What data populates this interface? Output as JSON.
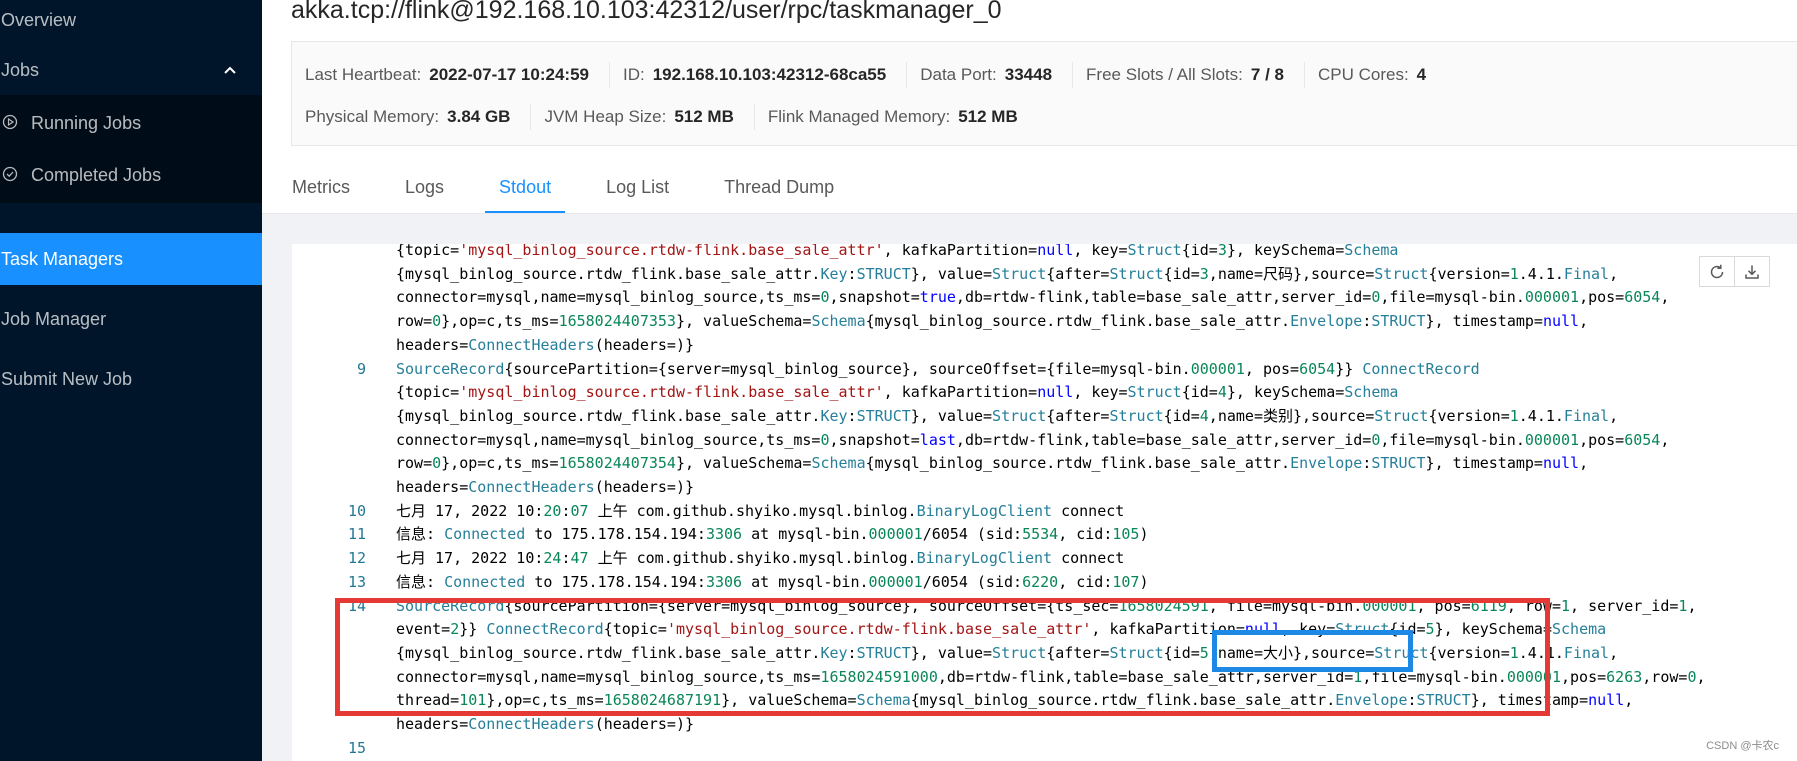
{
  "sidebar": {
    "items": [
      {
        "label": "Overview"
      },
      {
        "label": "Jobs"
      },
      {
        "label": "Running Jobs"
      },
      {
        "label": "Completed Jobs"
      },
      {
        "label": "Task Managers"
      },
      {
        "label": "Job Manager"
      },
      {
        "label": "Submit New Job"
      }
    ]
  },
  "header": {
    "title": "akka.tcp://flink@192.168.10.103:42312/user/rpc/taskmanager_0"
  },
  "descriptions": {
    "last_heartbeat_label": "Last Heartbeat:",
    "last_heartbeat": "2022-07-17 10:24:59",
    "id_label": "ID:",
    "id": "192.168.10.103:42312-68ca55",
    "data_port_label": "Data Port:",
    "data_port": "33448",
    "slots_label": "Free Slots / All Slots:",
    "slots": "7 / 8",
    "cpu_label": "CPU Cores:",
    "cpu": "4",
    "physical_memory_label": "Physical Memory:",
    "physical_memory": "3.84 GB",
    "jvm_heap_label": "JVM Heap Size:",
    "jvm_heap": "512 MB",
    "managed_memory_label": "Flink Managed Memory:",
    "managed_memory": "512 MB"
  },
  "tabs": [
    {
      "label": "Metrics"
    },
    {
      "label": "Logs"
    },
    {
      "label": "Stdout"
    },
    {
      "label": "Log List"
    },
    {
      "label": "Thread Dump"
    }
  ],
  "active_tab": "Stdout",
  "stdout_lines": [
    {
      "n": "",
      "text": "{topic='mysql_binlog_source.rtdw-flink.base_sale_attr', kafkaPartition=null, key=Struct{id=3}, keySchema=Schema"
    },
    {
      "n": "",
      "text": "{mysql_binlog_source.rtdw_flink.base_sale_attr.Key:STRUCT}, value=Struct{after=Struct{id=3,name=尺码},source=Struct{version=1.4.1.Final,"
    },
    {
      "n": "",
      "text": "connector=mysql,name=mysql_binlog_source,ts_ms=0,snapshot=true,db=rtdw-flink,table=base_sale_attr,server_id=0,file=mysql-bin.000001,pos=6054,"
    },
    {
      "n": "",
      "text": "row=0},op=c,ts_ms=1658024407353}, valueSchema=Schema{mysql_binlog_source.rtdw_flink.base_sale_attr.Envelope:STRUCT}, timestamp=null,"
    },
    {
      "n": "",
      "text": "headers=ConnectHeaders(headers=)}"
    },
    {
      "n": "9",
      "text": "SourceRecord{sourcePartition={server=mysql_binlog_source}, sourceOffset={file=mysql-bin.000001, pos=6054}} ConnectRecord"
    },
    {
      "n": "",
      "text": "{topic='mysql_binlog_source.rtdw-flink.base_sale_attr', kafkaPartition=null, key=Struct{id=4}, keySchema=Schema"
    },
    {
      "n": "",
      "text": "{mysql_binlog_source.rtdw_flink.base_sale_attr.Key:STRUCT}, value=Struct{after=Struct{id=4,name=类别},source=Struct{version=1.4.1.Final,"
    },
    {
      "n": "",
      "text": "connector=mysql,name=mysql_binlog_source,ts_ms=0,snapshot=last,db=rtdw-flink,table=base_sale_attr,server_id=0,file=mysql-bin.000001,pos=6054,"
    },
    {
      "n": "",
      "text": "row=0},op=c,ts_ms=1658024407354}, valueSchema=Schema{mysql_binlog_source.rtdw_flink.base_sale_attr.Envelope:STRUCT}, timestamp=null,"
    },
    {
      "n": "",
      "text": "headers=ConnectHeaders(headers=)}"
    },
    {
      "n": "10",
      "text": "七月 17, 2022 10:20:07 上午 com.github.shyiko.mysql.binlog.BinaryLogClient connect"
    },
    {
      "n": "11",
      "text": "信息: Connected to 175.178.154.194:3306 at mysql-bin.000001/6054 (sid:5534, cid:105)"
    },
    {
      "n": "12",
      "text": "七月 17, 2022 10:24:47 上午 com.github.shyiko.mysql.binlog.BinaryLogClient connect"
    },
    {
      "n": "13",
      "text": "信息: Connected to 175.178.154.194:3306 at mysql-bin.000001/6054 (sid:6220, cid:107)"
    },
    {
      "n": "14",
      "text": "SourceRecord{sourcePartition={server=mysql_binlog_source}, sourceOffset={ts_sec=1658024591, file=mysql-bin.000001, pos=6119, row=1, server_id=1,"
    },
    {
      "n": "",
      "text": "event=2}} ConnectRecord{topic='mysql_binlog_source.rtdw-flink.base_sale_attr', kafkaPartition=null, key=Struct{id=5}, keySchema=Schema"
    },
    {
      "n": "",
      "text": "{mysql_binlog_source.rtdw_flink.base_sale_attr.Key:STRUCT}, value=Struct{after=Struct{id=5,name=大小},source=Struct{version=1.4.1.Final,"
    },
    {
      "n": "",
      "text": "connector=mysql,name=mysql_binlog_source,ts_ms=1658024591000,db=rtdw-flink,table=base_sale_attr,server_id=1,file=mysql-bin.000001,pos=6263,row=0,"
    },
    {
      "n": "",
      "text": "thread=101},op=c,ts_ms=1658024687191}, valueSchema=Schema{mysql_binlog_source.rtdw_flink.base_sale_attr.Envelope:STRUCT}, timestamp=null,"
    },
    {
      "n": "",
      "text": "headers=ConnectHeaders(headers=)}"
    },
    {
      "n": "15",
      "text": ""
    }
  ],
  "colors": {
    "sidebar_bg": "#001529",
    "active_blue": "#1890ff",
    "highlight_red": "#e53935",
    "highlight_blue": "#1e88e5"
  },
  "icons": {
    "refresh": "refresh-icon",
    "download": "download-icon"
  },
  "watermark": "CSDN @卡农c"
}
